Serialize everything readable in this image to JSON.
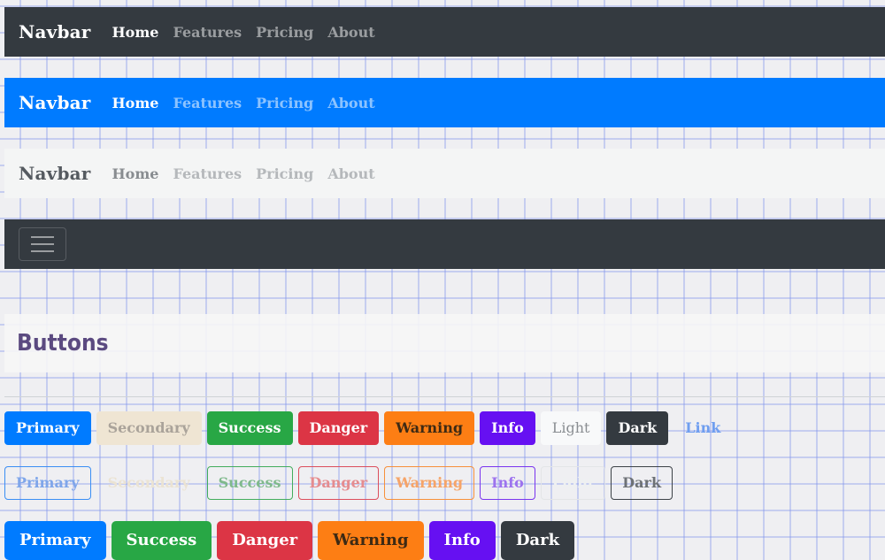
{
  "navbars": [
    {
      "brand": "Navbar",
      "links": [
        "Home",
        "Features",
        "Pricing",
        "About"
      ]
    },
    {
      "brand": "Navbar",
      "links": [
        "Home",
        "Features",
        "Pricing",
        "About"
      ]
    },
    {
      "brand": "Navbar",
      "links": [
        "Home",
        "Features",
        "Pricing",
        "About"
      ]
    }
  ],
  "buttons_section": {
    "title": "Buttons",
    "solid": [
      "Primary",
      "Secondary",
      "Success",
      "Danger",
      "Warning",
      "Info",
      "Light",
      "Dark",
      "Link"
    ],
    "outline": [
      "Primary",
      "Secondary",
      "Success",
      "Danger",
      "Warning",
      "Info",
      "Light",
      "Dark"
    ],
    "large": [
      "Primary",
      "Success",
      "Danger",
      "Warning",
      "Info",
      "Dark"
    ]
  },
  "icons": {
    "toggler": "hamburger-menu-icon"
  },
  "colors": {
    "primary": "#007bff",
    "secondary": "#efe5d3",
    "success": "#28a745",
    "danger": "#dc3545",
    "warning": "#fd7e14",
    "info": "#6610f2",
    "light": "#f8f9fa",
    "dark": "#343a40",
    "heading": "#5b4a80"
  }
}
